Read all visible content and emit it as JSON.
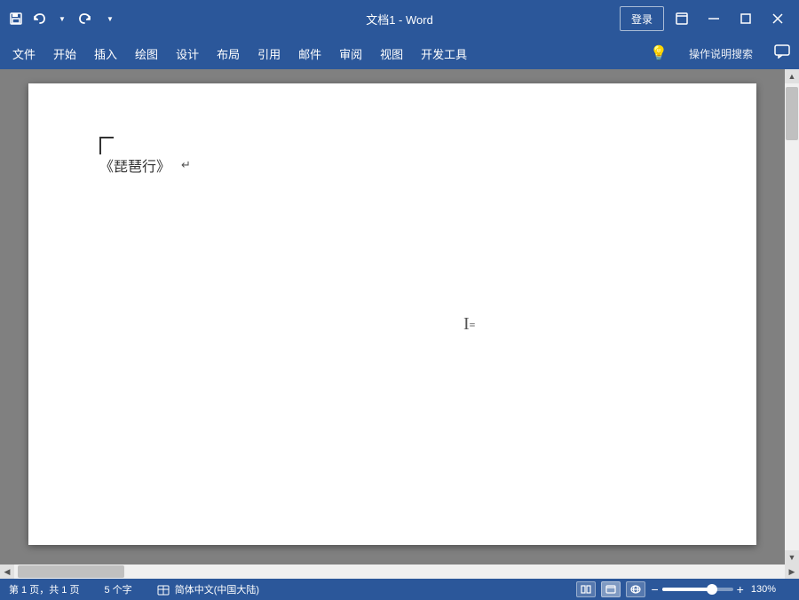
{
  "titlebar": {
    "title": "文档1 - Word",
    "login_label": "登录",
    "icons": {
      "save": "💾",
      "undo": "↩",
      "redo": "↪",
      "customize": "▼",
      "layout": "⊞",
      "minimize": "─",
      "maximize": "□",
      "close": "✕"
    }
  },
  "menubar": {
    "items": [
      "文件",
      "开始",
      "插入",
      "绘图",
      "设计",
      "布局",
      "引用",
      "邮件",
      "审阅",
      "视图",
      "开发工具"
    ],
    "right_icons": {
      "lightbulb": "💡",
      "search_label": "操作说明搜索",
      "comment": "💬"
    }
  },
  "document": {
    "content": "《琵琶行》",
    "paragraph_mark": "↵"
  },
  "statusbar": {
    "page_info": "第 1 页，共 1 页",
    "word_count": "5 个字",
    "language": "简体中文(中国大陆)",
    "zoom": "130%"
  }
}
